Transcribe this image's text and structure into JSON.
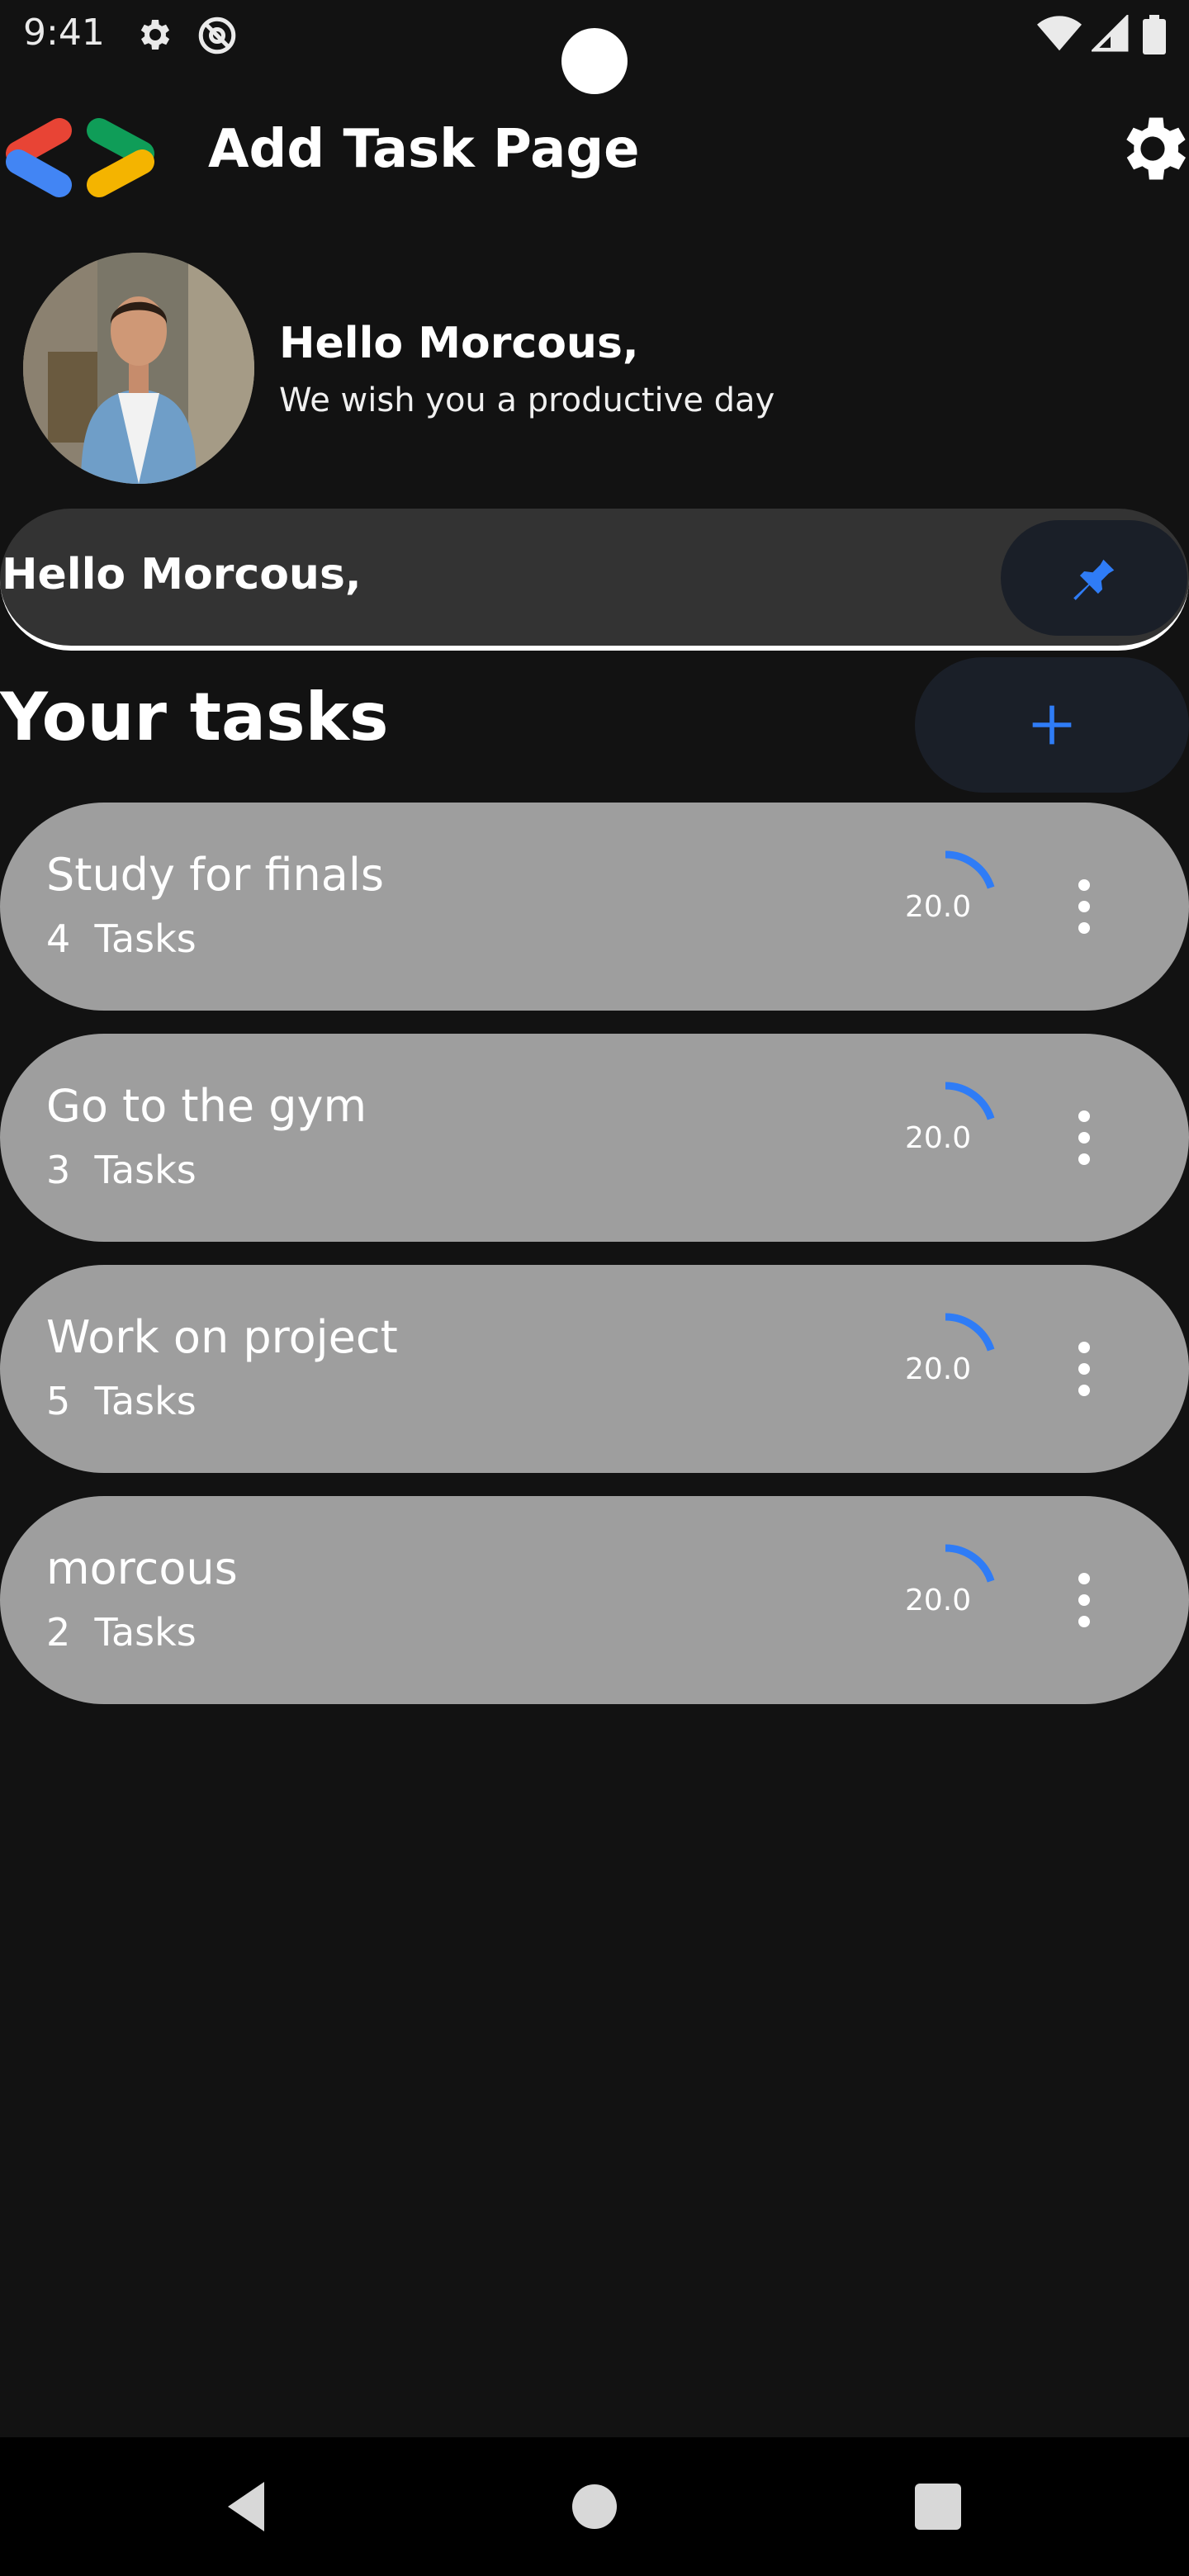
{
  "status_bar": {
    "time": "9:41",
    "icons": [
      "gear-icon",
      "at-sign-icon",
      "wifi-icon",
      "signal-icon",
      "battery-icon"
    ]
  },
  "app_bar": {
    "title": "Add Task Page",
    "logo_icon": "dev-chevrons-logo",
    "settings_icon": "gear-icon"
  },
  "profile": {
    "greeting": "Hello Morcous,",
    "subtitle": "We wish you a productive day"
  },
  "search_bar": {
    "text": "Hello Morcous,",
    "pin_icon": "pin-icon"
  },
  "tasks_section": {
    "heading": "Your tasks",
    "add_icon": "plus-icon"
  },
  "tasks": [
    {
      "title": "Study for finals",
      "count": "4  Tasks",
      "progress_label": "20.0",
      "progress": 0.2
    },
    {
      "title": "Go to the gym",
      "count": "3  Tasks",
      "progress_label": "20.0",
      "progress": 0.2
    },
    {
      "title": "Work on project",
      "count": "5  Tasks",
      "progress_label": "20.0",
      "progress": 0.2
    },
    {
      "title": "morcous",
      "count": "2  Tasks",
      "progress_label": "20.0",
      "progress": 0.2
    }
  ],
  "colors": {
    "background": "#121212",
    "accent": "#2f7cf6",
    "card": "#9e9e9e",
    "input": "#333333"
  },
  "nav_bar": {
    "icons": [
      "back-icon",
      "home-icon",
      "recents-icon"
    ]
  }
}
